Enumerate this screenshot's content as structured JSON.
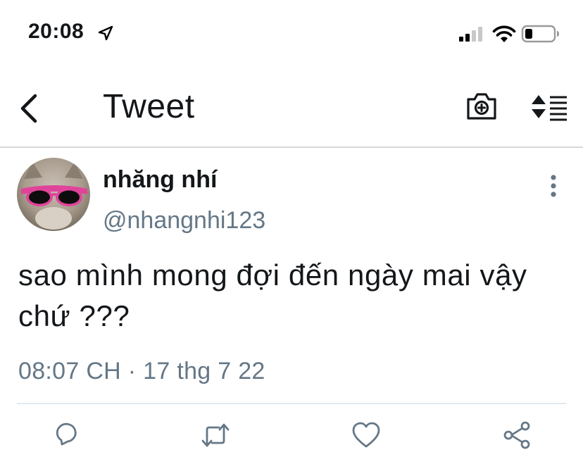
{
  "status_bar": {
    "time": "20:08",
    "icons": [
      "location-arrow-icon",
      "signal-bars-icon",
      "wifi-icon",
      "battery-icon"
    ]
  },
  "nav": {
    "back_icon": "chevron-left-icon",
    "title": "Tweet",
    "camera_icon": "camera-plus-icon",
    "sort_icon": "sort-list-icon"
  },
  "tweet": {
    "display_name": "nhăng nhí",
    "handle": "@nhangnhi123",
    "text": "sao mình mong đợi đến ngày mai vậy chứ ???",
    "time": "08:07 CH",
    "separator": "·",
    "date": "17 thg 7 22",
    "more_icon": "more-vertical-icon"
  },
  "actions": [
    "reply-icon",
    "retweet-icon",
    "like-icon",
    "share-icon"
  ],
  "colors": {
    "text": "#14171a",
    "secondary": "#657786",
    "divider": "#e1e8ed",
    "nav_border": "#d8d8d8"
  }
}
